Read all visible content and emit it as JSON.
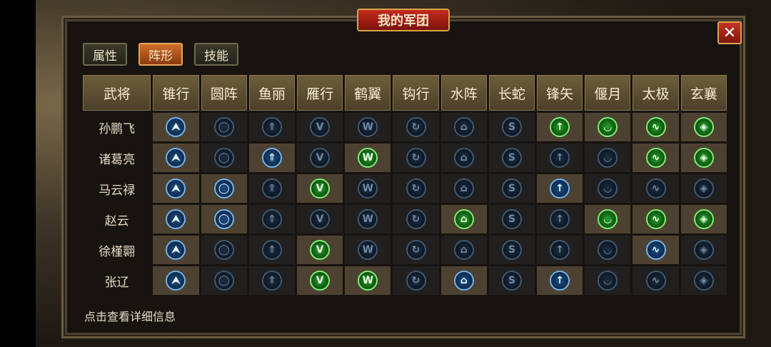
{
  "window": {
    "title": "我的军团",
    "close_label": "✕"
  },
  "tabs": [
    "属性",
    "阵形",
    "技能"
  ],
  "active_tab": 1,
  "table": {
    "general_header": "武将",
    "formations": [
      "锥行",
      "圆阵",
      "鱼丽",
      "雁行",
      "鹤翼",
      "钩行",
      "水阵",
      "长蛇",
      "锋矢",
      "偃月",
      "太极",
      "玄襄"
    ],
    "icon_glyphs": [
      "⮝",
      "◯",
      "⇑",
      "V",
      "W",
      "↻",
      "⌂",
      "S",
      "↑",
      "◡",
      "∿",
      "◈"
    ],
    "rows": [
      {
        "name": "孙鹏飞",
        "states": [
          "hb",
          "d",
          "d",
          "d",
          "d",
          "d",
          "d",
          "d",
          "hg",
          "hg",
          "hg",
          "hg"
        ]
      },
      {
        "name": "诸葛亮",
        "states": [
          "hb",
          "d",
          "hb",
          "d",
          "hg",
          "d",
          "d",
          "d",
          "d",
          "d",
          "hg",
          "hg"
        ]
      },
      {
        "name": "马云禄",
        "states": [
          "hb",
          "hb",
          "d",
          "hg",
          "d",
          "d",
          "d",
          "d",
          "hb",
          "d",
          "d",
          "d"
        ]
      },
      {
        "name": "赵云",
        "states": [
          "hb",
          "hb",
          "d",
          "d",
          "d",
          "d",
          "hg",
          "d",
          "d",
          "hg",
          "hg",
          "hg"
        ]
      },
      {
        "name": "徐槿翾",
        "states": [
          "hb",
          "d",
          "d",
          "hg",
          "d",
          "d",
          "d",
          "d",
          "d",
          "d",
          "hb",
          "d"
        ]
      },
      {
        "name": "张辽",
        "states": [
          "hb",
          "d",
          "d",
          "hg",
          "hg",
          "d",
          "hb",
          "d",
          "hb",
          "d",
          "d",
          "d"
        ]
      }
    ]
  },
  "footer_hint": "点击查看详细信息",
  "colors": {
    "accent_red": "#c62a1c",
    "active_tab": "#cf6f2a",
    "learned_green": "#24a62b",
    "learned_blue": "#1a4f86"
  }
}
